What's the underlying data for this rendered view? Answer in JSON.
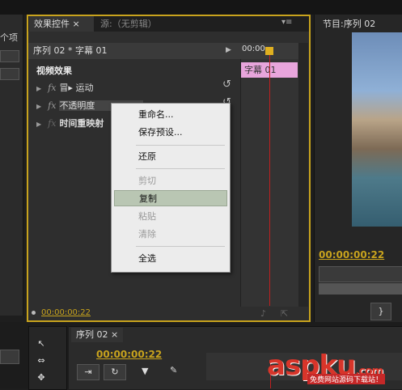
{
  "left_panel": {
    "label": "个项"
  },
  "effect_controls": {
    "tab_active": "效果控件 ×",
    "tab_inactive": "源:（无剪辑）",
    "menu_glyph": "▾≡",
    "subheader": "序列 02 * 字幕 01",
    "ruler_time": "00:00",
    "clip_label": "字幕 01",
    "section_title": "视频效果",
    "rows": [
      {
        "label": "运动",
        "fx": "fx",
        "prefix": "冒▸"
      },
      {
        "label": "不透明度",
        "fx": "fx"
      },
      {
        "label": "时间重映射",
        "fx": "fx"
      }
    ],
    "footer_time": "00:00:00:22"
  },
  "context_menu": {
    "items": [
      {
        "label": "重命名...",
        "enabled": true
      },
      {
        "label": "保存预设...",
        "enabled": true
      },
      {
        "label": "还原",
        "enabled": true
      },
      {
        "label": "剪切",
        "enabled": false
      },
      {
        "label": "复制",
        "enabled": true,
        "selected": true
      },
      {
        "label": "粘贴",
        "enabled": false
      },
      {
        "label": "清除",
        "enabled": false
      },
      {
        "label": "全选",
        "enabled": true
      }
    ]
  },
  "program_monitor": {
    "tab": "节目:序列 02",
    "timecode": "00:00:00:22"
  },
  "sequence": {
    "tab": "序列 02 ×",
    "timecode": "00:00:00:22"
  },
  "watermark": {
    "text": "aspku",
    "suffix": ".com",
    "sub": "免费网站源码下载站！"
  },
  "colors": {
    "accent": "#c8a31d",
    "clip": "#e8a5dc",
    "playhead": "#c02020"
  }
}
